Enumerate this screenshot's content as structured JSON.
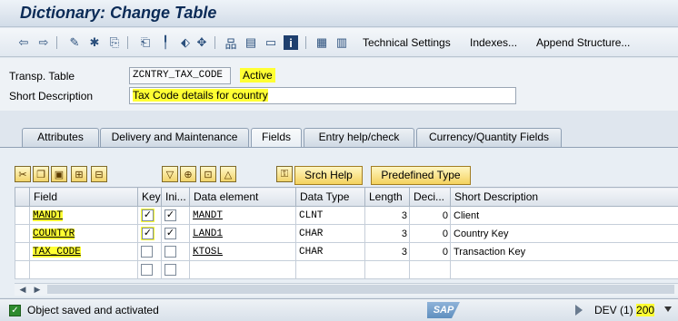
{
  "window": {
    "title": "Dictionary: Change Table"
  },
  "toolbar": {
    "icons": [
      "back-arrow-icon",
      "forward-arrow-icon",
      "edit-pencil-icon",
      "activate-icon",
      "check-icon",
      "where-used-icon",
      "display-object-icon",
      "navigate-icon",
      "hierarchy-icon",
      "layout-icon",
      "screen-icon",
      "info-icon",
      "relationships-icon",
      "table-icon"
    ],
    "technical_settings": "Technical Settings",
    "indexes": "Indexes...",
    "append_structure": "Append Structure..."
  },
  "header": {
    "table_label": "Transp. Table",
    "table_name": "ZCNTRY_TAX_CODE",
    "status": "Active",
    "short_desc_label": "Short Description",
    "short_desc": "Tax Code details for country"
  },
  "tabs": [
    {
      "label": "Attributes"
    },
    {
      "label": "Delivery and Maintenance"
    },
    {
      "label": "Fields",
      "active": true
    },
    {
      "label": "Entry help/check"
    },
    {
      "label": "Currency/Quantity Fields"
    }
  ],
  "fields_toolbar": {
    "srch_help": "Srch Help",
    "predefined_type": "Predefined Type"
  },
  "grid": {
    "columns": [
      "Field",
      "Key",
      "Ini...",
      "Data element",
      "Data Type",
      "Length",
      "Deci...",
      "Short Description"
    ],
    "rows": [
      {
        "field": "MANDT",
        "key": true,
        "initial": true,
        "data_element": "MANDT",
        "data_type": "CLNT",
        "length": "3",
        "decimals": "0",
        "desc": "Client"
      },
      {
        "field": "COUNTYR",
        "key": true,
        "initial": true,
        "data_element": "LAND1",
        "data_type": "CHAR",
        "length": "3",
        "decimals": "0",
        "desc": "Country Key"
      },
      {
        "field": "TAX_CODE",
        "key": false,
        "initial": false,
        "data_element": "KTOSL",
        "data_type": "CHAR",
        "length": "3",
        "decimals": "0",
        "desc": "Transaction Key"
      },
      {
        "field": "",
        "key": false,
        "initial": false,
        "data_element": "",
        "data_type": "",
        "length": "",
        "decimals": "",
        "desc": ""
      }
    ]
  },
  "status_bar": {
    "message": "Object saved and activated",
    "logo": "SAP",
    "system": "DEV (1)",
    "client": "200"
  },
  "colors": {
    "highlight": "#ffff33",
    "title": "#0b2b57",
    "button_yellow": "#f4d25e",
    "ok_green": "#2e8b2e"
  }
}
